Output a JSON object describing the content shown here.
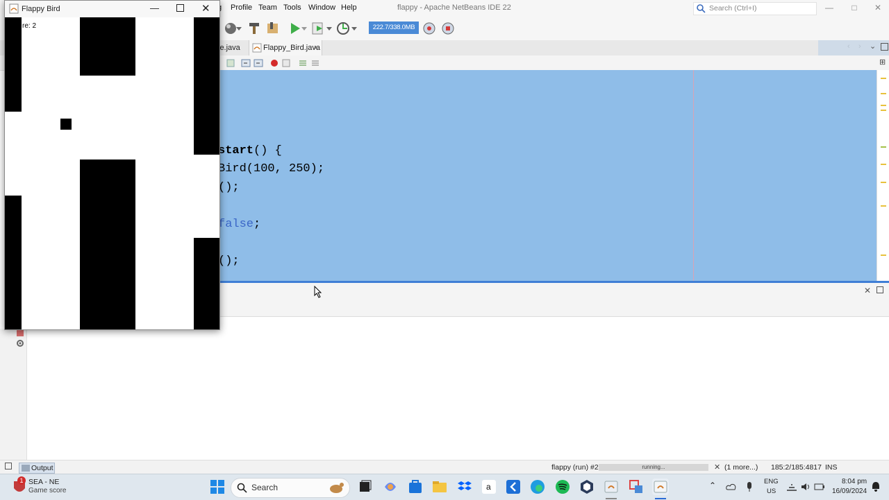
{
  "ide": {
    "menu": [
      "g",
      "Profile",
      "Team",
      "Tools",
      "Window",
      "Help"
    ],
    "title": "flappy - Apache NetBeans IDE 22",
    "search_placeholder": "Search (Ctrl+I)",
    "memory": "222.7/338.0MB",
    "tabs": [
      {
        "label": "le.java",
        "close": "×"
      },
      {
        "label": "Flappy_Bird.java",
        "close": "×"
      }
    ],
    "code_lines": [
      {
        "bold": "start",
        "rest": "() {",
        "kw": ""
      },
      {
        "bold": "",
        "rest": "Bird(100, 250);",
        "kw": ""
      },
      {
        "bold": "",
        "rest": "();",
        "kw": ""
      },
      {
        "bold": "",
        "rest": "",
        "kw": ""
      },
      {
        "bold": "",
        "rest": ";",
        "kw": "false"
      },
      {
        "bold": "",
        "rest": "",
        "kw": ""
      },
      {
        "bold": "",
        "rest": "();",
        "kw": ""
      }
    ],
    "status": {
      "output_tab": "Output",
      "run_label": "flappy (run) #2",
      "progress_text": "running...",
      "more": "(1 more...)",
      "position": "185:2/185:4817",
      "mode": "INS"
    },
    "colors": {
      "editor_selection": "#8fbde8",
      "accent": "#3f7ed6",
      "keyword": "#3a66c7"
    }
  },
  "game": {
    "window_title": "Flappy Bird",
    "score_text": "re: 2"
  },
  "taskbar": {
    "weather_title": "SEA - NE",
    "weather_sub": "Game score",
    "badge": "1",
    "search_label": "Search",
    "lang_top": "ENG",
    "lang_bottom": "US",
    "time": "8:04 pm",
    "date": "16/09/2024"
  }
}
